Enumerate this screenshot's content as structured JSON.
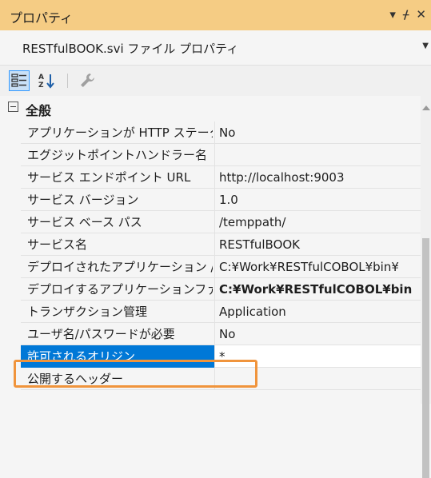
{
  "window": {
    "title": "プロパティ",
    "controls": [
      "▾",
      "ᚋ",
      "✕"
    ]
  },
  "object_selector": {
    "text": "RESTfulBOOK.svi ファイル プロパティ",
    "dropdown": "▼"
  },
  "toolbar": {
    "buttons": [
      "categorized",
      "alphabetical",
      "property-pages"
    ]
  },
  "grid": {
    "category": {
      "expander": "−",
      "label": "全般"
    },
    "rows": [
      {
        "name": "アプリケーションが HTTP ステータ",
        "value": "No",
        "bold": false
      },
      {
        "name": "エグジットポイントハンドラー名",
        "value": "",
        "bold": false
      },
      {
        "name": "サービス エンドポイント URL",
        "value": "http://localhost:9003",
        "bold": false
      },
      {
        "name": "サービス バージョン",
        "value": "1.0",
        "bold": false
      },
      {
        "name": "サービス ベース パス",
        "value": "/temppath/",
        "bold": false
      },
      {
        "name": "サービス名",
        "value": "RESTfulBOOK",
        "bold": false
      },
      {
        "name": "デプロイされたアプリケーション /",
        "value": "C:¥Work¥RESTfulCOBOL¥bin¥",
        "bold": false
      },
      {
        "name": "デプロイするアプリケーションファ",
        "value": "C:¥Work¥RESTfulCOBOL¥bin",
        "bold": true
      },
      {
        "name": "トランザクション管理",
        "value": "Application",
        "bold": false
      },
      {
        "name": "ユーザ名/パスワードが必要",
        "value": "No",
        "bold": false
      },
      {
        "name": "許可されるオリジン",
        "value": "*",
        "bold": false,
        "selected": true
      },
      {
        "name": "公開するヘッダー",
        "value": "",
        "bold": false
      }
    ]
  },
  "colors": {
    "titlebar": "#f5cc84",
    "selection": "#0078d7",
    "highlight_box": "#f0943c"
  }
}
